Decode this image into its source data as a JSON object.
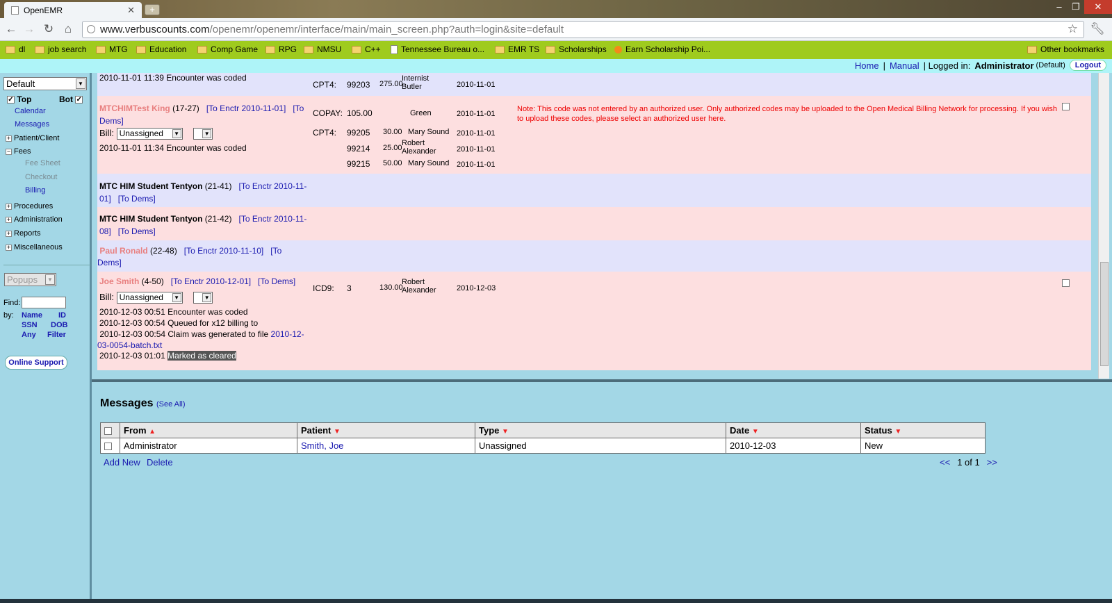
{
  "browser": {
    "tab_title": "OpenEMR",
    "url_host": "www.verbuscounts.com",
    "url_path": "/openemr/openemr/interface/main/main_screen.php?auth=login&site=default",
    "bookmarks": [
      {
        "label": "dl",
        "kind": "folder"
      },
      {
        "label": "job search",
        "kind": "folder"
      },
      {
        "label": "MTG",
        "kind": "folder"
      },
      {
        "label": "Education",
        "kind": "folder"
      },
      {
        "label": "Comp Game",
        "kind": "folder"
      },
      {
        "label": "RPG",
        "kind": "folder"
      },
      {
        "label": "NMSU",
        "kind": "folder"
      },
      {
        "label": "C++",
        "kind": "folder"
      },
      {
        "label": "Tennessee Bureau o...",
        "kind": "page"
      },
      {
        "label": "EMR TS",
        "kind": "folder"
      },
      {
        "label": "Scholarships",
        "kind": "folder"
      },
      {
        "label": "Earn Scholarship Poi...",
        "kind": "site"
      }
    ],
    "other_bookmarks": "Other bookmarks"
  },
  "topbar": {
    "home": "Home",
    "sep1": "|",
    "manual": "Manual",
    "logged_in_label": "| Logged in:",
    "user": "Administrator",
    "site": "(Default)",
    "logout": "Logout"
  },
  "nav": {
    "layout_select": "Default",
    "top_label": "Top",
    "bot_label": "Bot",
    "calendar": "Calendar",
    "messages": "Messages",
    "patient_client": "Patient/Client",
    "fees": "Fees",
    "fee_sheet": "Fee Sheet",
    "checkout": "Checkout",
    "billing": "Billing",
    "procedures": "Procedures",
    "administration": "Administration",
    "reports": "Reports",
    "miscellaneous": "Miscellaneous",
    "popups": "Popups",
    "find_label": "Find:",
    "by_label": "by:",
    "find_name": "Name",
    "find_id": "ID",
    "find_ssn": "SSN",
    "find_dob": "DOB",
    "find_any": "Any",
    "find_filter": "Filter",
    "online_support": "Online Support"
  },
  "billing": {
    "r0": {
      "log": "2010-11-01 11:39 Encounter was coded",
      "code_type": "CPT4:",
      "code": "99203",
      "fee": "275.00",
      "provider": "Internist Butler",
      "date": "2010-11-01"
    },
    "r1": {
      "name": "MTCHIMTest King",
      "pid": "(17-27)",
      "enc_link": "[To Enctr 2010-11-01]",
      "dems_link": "[To Dems]",
      "bill_label": "Bill:",
      "bill_value": "Unassigned",
      "log": "2010-11-01 11:34 Encounter was coded",
      "copay_label": "COPAY:",
      "copay_value": "105.00",
      "copay_provider": "Green",
      "copay_date": "2010-11-01",
      "lines": [
        {
          "type": "CPT4:",
          "code": "99205",
          "fee": "30.00",
          "provider": "Mary Sound",
          "date": "2010-11-01"
        },
        {
          "type": "",
          "code": "99214",
          "fee": "25.00",
          "provider": "Robert Alexander",
          "date": "2010-11-01"
        },
        {
          "type": "",
          "code": "99215",
          "fee": "50.00",
          "provider": "Mary Sound",
          "date": "2010-11-01"
        }
      ],
      "note": "Note: This code was not entered by an authorized user. Only authorized codes may be uploaded to the Open Medical Billing Network for processing. If you wish to upload these codes, please select an authorized user here."
    },
    "r2": {
      "name": "MTC HIM Student Tentyon",
      "pid": "(21-41)",
      "enc_link": "[To Enctr 2010-11-01]",
      "dems_link": "[To Dems]"
    },
    "r3": {
      "name": "MTC HIM Student Tentyon",
      "pid": "(21-42)",
      "enc_link": "[To Enctr 2010-11-08]",
      "dems_link": "[To Dems]"
    },
    "r4": {
      "name": "Paul Ronald",
      "pid": "(22-48)",
      "enc_link": "[To Enctr 2010-11-10]",
      "dems_link": "[To Dems]"
    },
    "r5": {
      "name": "Joe Smith",
      "pid": "(4-50)",
      "enc_link": "[To Enctr 2010-12-01]",
      "dems_link": "[To Dems]",
      "bill_label": "Bill:",
      "bill_value": "Unassigned",
      "code_type": "ICD9:",
      "code": "3",
      "fee": "130.00",
      "provider": "Robert Alexander",
      "date": "2010-12-03",
      "log1": "2010-12-03 00:51 Encounter was coded",
      "log2": "2010-12-03 00:54 Queued for x12 billing to",
      "log3": "2010-12-03 00:54 Claim was generated to file",
      "log3_file": "2010-12-03-0054-batch.txt",
      "log4_time": "2010-12-03 01:01",
      "log4_text": "Marked as cleared"
    }
  },
  "messages": {
    "title": "Messages",
    "see_all": "(See All)",
    "headers": {
      "from": "From",
      "patient": "Patient",
      "type": "Type",
      "date": "Date",
      "status": "Status"
    },
    "row": {
      "from": "Administrator",
      "patient": "Smith, Joe",
      "type": "Unassigned",
      "date": "2010-12-03",
      "status": "New"
    },
    "add_new": "Add New",
    "delete": "Delete",
    "pager": {
      "prev": "<<",
      "page": "1 of 1",
      "next": ">>"
    }
  },
  "colors": {
    "pink_row": "#fddfe0",
    "lavender_row": "#e2e3fb",
    "panel": "#a3d7e6",
    "bookmark_bar": "#9fcb1e"
  }
}
